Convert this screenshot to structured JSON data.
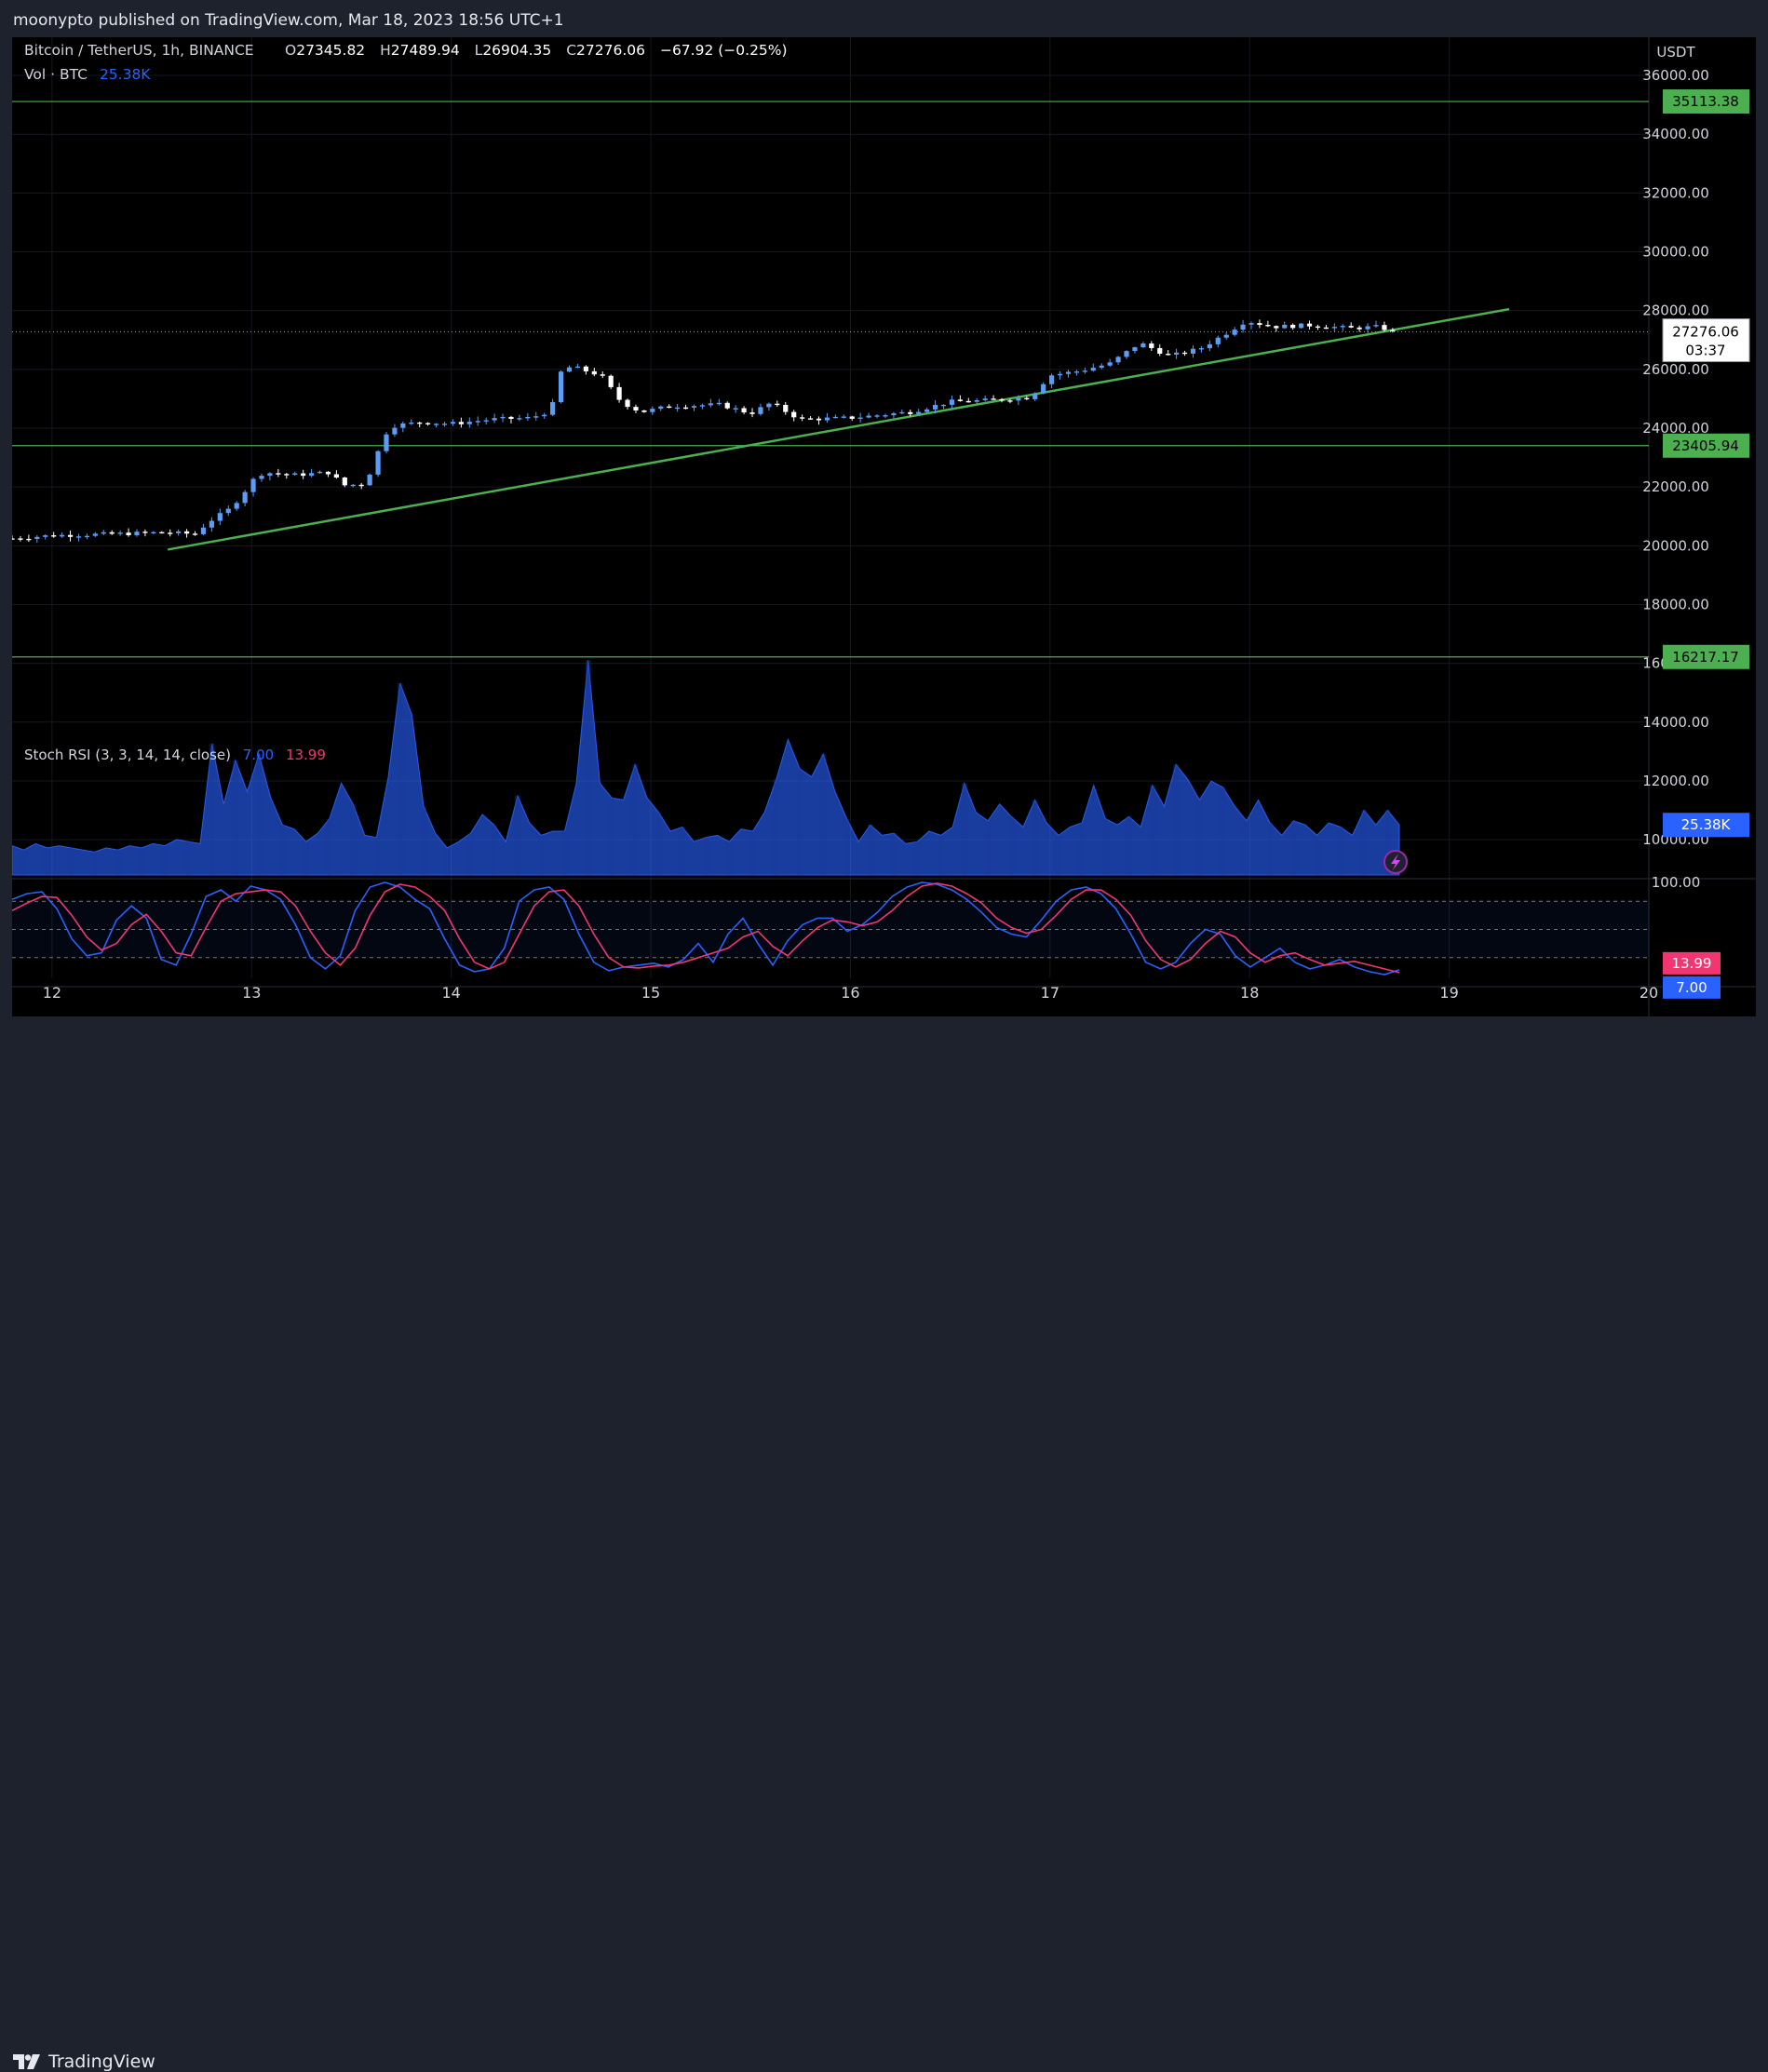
{
  "publisher": "moonypto published on TradingView.com, Mar 18, 2023 18:56 UTC+1",
  "footer_brand": "TradingView",
  "header": {
    "symbol": "Bitcoin / TetherUS, 1h, BINANCE",
    "o_label": "O",
    "o_value": "27345.82",
    "h_label": "H",
    "h_value": "27489.94",
    "l_label": "L",
    "l_value": "26904.35",
    "c_label": "C",
    "c_value": "27276.06",
    "change": "−67.92 (−0.25%)",
    "vol_label": "Vol · BTC",
    "vol_value": "25.38K"
  },
  "colors": {
    "up": "#5b9cf6",
    "down": "#ffffff",
    "trendline": "#4caf50",
    "hline": "#4caf50",
    "volume": "#2962ff",
    "k_line": "#2962ff",
    "d_line": "#f23672",
    "label_green": "#4caf50",
    "label_blue": "#2962ff",
    "label_pink": "#f23672"
  },
  "chart_data": [
    {
      "type": "candlestick",
      "title": "Bitcoin / TetherUS, 1h, BINANCE",
      "ylabel": "USDT",
      "ylim": [
        8800,
        37300
      ],
      "y_ticks": [
        "36000.00",
        "34000.00",
        "32000.00",
        "30000.00",
        "28000.00",
        "26000.00",
        "24000.00",
        "22000.00",
        "20000.00",
        "18000.00",
        "16000.00",
        "14000.00",
        "12000.00",
        "10000.00"
      ],
      "x_range_days": [
        11.8,
        20.0
      ],
      "x_ticks": [
        {
          "day": 12,
          "label": "12"
        },
        {
          "day": 13,
          "label": "13"
        },
        {
          "day": 14,
          "label": "14"
        },
        {
          "day": 15,
          "label": "15"
        },
        {
          "day": 16,
          "label": "16"
        },
        {
          "day": 17,
          "label": "17"
        },
        {
          "day": 18,
          "label": "18"
        },
        {
          "day": 19,
          "label": "19"
        },
        {
          "day": 20,
          "label": "20"
        }
      ],
      "horizontal_levels": [
        {
          "value": 35113.38,
          "label": "35113.38"
        },
        {
          "value": 23405.94,
          "label": "23405.94"
        },
        {
          "value": 16217.17,
          "label": "16217.17"
        }
      ],
      "trendline": {
        "from": [
          12.58,
          19870
        ],
        "to": [
          19.3,
          28050
        ]
      },
      "last_price": {
        "value": 27276.06,
        "label": "27276.06",
        "countdown": "03:37"
      },
      "price_path": [
        [
          11.8,
          20250
        ],
        [
          12.0,
          20350
        ],
        [
          12.3,
          20400
        ],
        [
          12.55,
          20450
        ],
        [
          12.72,
          20400
        ],
        [
          12.78,
          20800
        ],
        [
          12.88,
          21200
        ],
        [
          12.95,
          21700
        ],
        [
          13.0,
          22200
        ],
        [
          13.06,
          22500
        ],
        [
          13.2,
          22400
        ],
        [
          13.4,
          22500
        ],
        [
          13.45,
          22050
        ],
        [
          13.56,
          22100
        ],
        [
          13.62,
          22800
        ],
        [
          13.65,
          23700
        ],
        [
          13.72,
          24100
        ],
        [
          13.85,
          24200
        ],
        [
          14.0,
          24150
        ],
        [
          14.2,
          24300
        ],
        [
          14.4,
          24350
        ],
        [
          14.5,
          24600
        ],
        [
          14.55,
          25900
        ],
        [
          14.6,
          26100
        ],
        [
          14.75,
          25800
        ],
        [
          14.85,
          24900
        ],
        [
          14.95,
          24550
        ],
        [
          15.1,
          24750
        ],
        [
          15.35,
          24800
        ],
        [
          15.5,
          24500
        ],
        [
          15.6,
          24850
        ],
        [
          15.75,
          24300
        ],
        [
          16.0,
          24350
        ],
        [
          16.3,
          24550
        ],
        [
          16.5,
          24900
        ],
        [
          16.7,
          24950
        ],
        [
          16.9,
          25050
        ],
        [
          17.0,
          25800
        ],
        [
          17.15,
          25950
        ],
        [
          17.3,
          26200
        ],
        [
          17.45,
          26900
        ],
        [
          17.6,
          26450
        ],
        [
          17.75,
          26700
        ],
        [
          17.9,
          27300
        ],
        [
          17.98,
          27650
        ],
        [
          18.12,
          27450
        ],
        [
          18.3,
          27500
        ],
        [
          18.5,
          27400
        ],
        [
          18.65,
          27450
        ],
        [
          18.72,
          27276
        ]
      ],
      "volume": {
        "last_label": "25.38K",
        "values": [
          1.4,
          1.2,
          1.5,
          1.3,
          1.4,
          1.3,
          1.2,
          1.1,
          1.3,
          1.2,
          1.4,
          1.3,
          1.5,
          1.4,
          1.7,
          1.6,
          1.5,
          6.3,
          3.4,
          5.5,
          4.0,
          5.8,
          3.7,
          2.4,
          2.2,
          1.6,
          2.0,
          2.7,
          4.4,
          3.4,
          1.9,
          1.8,
          4.7,
          9.2,
          7.7,
          3.3,
          2.0,
          1.3,
          1.6,
          2.0,
          2.9,
          2.4,
          1.6,
          3.8,
          2.5,
          1.9,
          2.1,
          2.1,
          4.4,
          10.3,
          4.4,
          3.7,
          3.6,
          5.3,
          3.7,
          3.0,
          2.1,
          2.3,
          1.6,
          1.8,
          1.9,
          1.6,
          2.2,
          2.1,
          3.0,
          4.6,
          6.5,
          5.1,
          4.7,
          5.8,
          4.0,
          2.7,
          1.6,
          2.4,
          1.9,
          2.0,
          1.5,
          1.6,
          2.1,
          1.9,
          2.3,
          4.4,
          3.0,
          2.6,
          3.4,
          2.8,
          2.3,
          3.6,
          2.5,
          1.9,
          2.3,
          2.5,
          4.3,
          2.7,
          2.4,
          2.8,
          2.3,
          4.3,
          3.3,
          5.3,
          4.6,
          3.6,
          4.5,
          4.2,
          3.3,
          2.6,
          3.6,
          2.5,
          1.9,
          2.6,
          2.4,
          1.9,
          2.5,
          2.3,
          1.9,
          3.1,
          2.4,
          3.1,
          2.4
        ]
      }
    },
    {
      "type": "line",
      "title": "Stoch RSI (3, 3, 14, 14, close)",
      "ylim": [
        -2,
        100
      ],
      "y_ticks": [
        "100.00"
      ],
      "levels": [
        80,
        50,
        20
      ],
      "series": [
        {
          "name": "K",
          "last_label": "7.00",
          "values": [
            82,
            88,
            90,
            72,
            40,
            22,
            25,
            60,
            75,
            62,
            18,
            12,
            45,
            85,
            92,
            80,
            96,
            92,
            82,
            55,
            20,
            8,
            22,
            70,
            95,
            100,
            95,
            82,
            72,
            40,
            12,
            5,
            8,
            30,
            80,
            92,
            95,
            82,
            45,
            15,
            6,
            10,
            12,
            14,
            10,
            18,
            35,
            15,
            45,
            62,
            35,
            12,
            38,
            55,
            62,
            62,
            48,
            55,
            68,
            85,
            95,
            100,
            98,
            92,
            82,
            68,
            52,
            45,
            42,
            60,
            80,
            92,
            95,
            88,
            72,
            45,
            15,
            8,
            15,
            35,
            50,
            45,
            22,
            10,
            20,
            30,
            15,
            8,
            12,
            18,
            10,
            5,
            2,
            7
          ]
        },
        {
          "name": "D",
          "last_label": "13.99",
          "values": [
            70,
            78,
            85,
            84,
            65,
            42,
            28,
            35,
            55,
            66,
            48,
            25,
            22,
            52,
            80,
            88,
            90,
            92,
            90,
            75,
            48,
            25,
            12,
            30,
            65,
            90,
            98,
            95,
            85,
            70,
            40,
            15,
            8,
            15,
            45,
            75,
            90,
            92,
            75,
            45,
            20,
            10,
            9,
            11,
            12,
            15,
            20,
            25,
            30,
            42,
            48,
            32,
            22,
            38,
            52,
            60,
            58,
            54,
            58,
            70,
            85,
            96,
            99,
            96,
            88,
            78,
            62,
            52,
            46,
            50,
            65,
            82,
            92,
            92,
            82,
            65,
            38,
            18,
            10,
            18,
            35,
            48,
            42,
            25,
            15,
            22,
            25,
            18,
            12,
            14,
            16,
            12,
            8,
            4
          ]
        }
      ]
    }
  ]
}
